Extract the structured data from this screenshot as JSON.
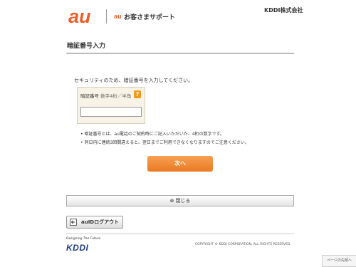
{
  "header": {
    "logo_text": "au",
    "brand_prefix": "au",
    "brand_text": "お客さまサポート",
    "corp": "KDDI株式会社"
  },
  "page": {
    "title": "暗証番号入力",
    "instruction": "セキュリティのため、暗証番号を入力してください。"
  },
  "pin": {
    "label": "暗証番号",
    "hint": "数字4桁／半角",
    "help": "?",
    "value": ""
  },
  "notes": [
    "暗証番号とは、au電話のご契約時にご記入いただいた、4桁の数字です。",
    "同日内に連続3回間違えると、翌日までご利用できなくなりますのでご注意ください。"
  ],
  "actions": {
    "next": "次へ",
    "close": "閉じる",
    "close_icon": "⊗",
    "logout": "auIDログアウト"
  },
  "footer": {
    "tagline": "Designing The Future",
    "logo": "KDDI",
    "copyright": "COPYRIGHT © KDDI CORPORATION, ALL RIGHTS RESERVED.",
    "page_top": "ページの先頭へ"
  },
  "colors": {
    "accent": "#e8602c",
    "button": "#f08a2e",
    "kddi_blue": "#1c3a8a"
  }
}
